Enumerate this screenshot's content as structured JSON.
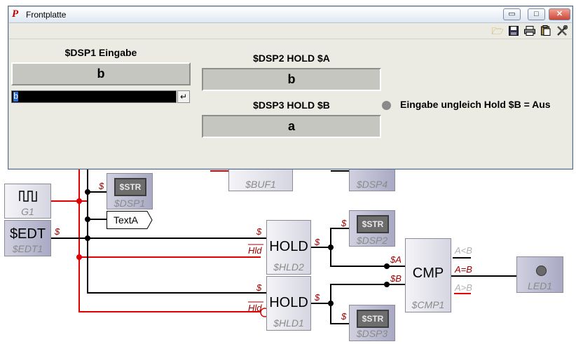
{
  "window": {
    "title": "Frontplatte",
    "buttons": {
      "minimize": "▭",
      "maximize": "□",
      "close": "✕"
    },
    "toolbar_icons": [
      "open-folder-icon",
      "save-icon",
      "print-icon",
      "paste-icon",
      "settings-tools-icon"
    ]
  },
  "panel": {
    "dsp1": {
      "label": "$DSP1 Eingabe",
      "value": "b"
    },
    "input": {
      "value": "b",
      "enter_glyph": "↵"
    },
    "dsp2": {
      "label": "$DSP2 HOLD $A",
      "value": "b"
    },
    "dsp3": {
      "label": "$DSP3 HOLD $B",
      "value": "a"
    },
    "led": {
      "label": "Eingabe ungleich Hold $B = Aus",
      "color": "#8a8a8a"
    }
  },
  "circuit": {
    "g1": {
      "name": "G1",
      "icon": "square-wave-icon"
    },
    "edt1": {
      "main": "$EDT",
      "name": "$EDT1",
      "port": "$"
    },
    "str_dsp1": {
      "main": "$STR",
      "name": "$DSP1",
      "port": "$"
    },
    "buf1": {
      "name": "$BUF1"
    },
    "dsp4": {
      "name": "$DSP4"
    },
    "textA": {
      "text": "TextA"
    },
    "hld2": {
      "main": "HOLD",
      "name": "$HLD2",
      "in_port": "$",
      "hold_port": "Hld",
      "out_port": "$"
    },
    "hld1": {
      "main": "HOLD",
      "name": "$HLD1",
      "in_port": "$",
      "hold_port": "Hld",
      "out_port": "$"
    },
    "str_dsp2": {
      "main": "$STR",
      "name": "$DSP2",
      "port": "$"
    },
    "str_dsp3": {
      "main": "$STR",
      "name": "$DSP3",
      "port": "$"
    },
    "cmp1": {
      "main": "CMP",
      "name": "$CMP1",
      "in_a": "$A",
      "in_b": "$B",
      "out_lt": "A<B",
      "out_eq": "A=B",
      "out_gt": "A>B"
    },
    "led1": {
      "name": "LED1"
    }
  },
  "colors": {
    "signal_red": "#e00000",
    "wire_black": "#000000",
    "port_label": "#a00000"
  }
}
